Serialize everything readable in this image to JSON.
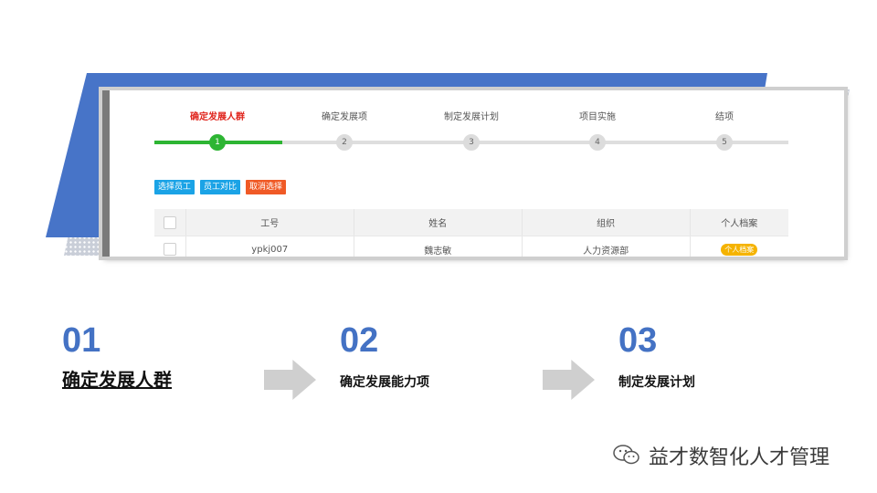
{
  "steps": [
    {
      "label": "确定发展人群",
      "num": "1"
    },
    {
      "label": "确定发展项",
      "num": "2"
    },
    {
      "label": "制定发展计划",
      "num": "3"
    },
    {
      "label": "项目实施",
      "num": "4"
    },
    {
      "label": "结项",
      "num": "5"
    }
  ],
  "buttons": {
    "select_employee": "选择员工",
    "compare_employee": "员工对比",
    "cancel_select": "取消选择"
  },
  "table": {
    "headers": [
      "工号",
      "姓名",
      "组织",
      "个人档案"
    ],
    "rows": [
      {
        "id": "ypkj007",
        "name": "魏志敏",
        "org": "人力资源部",
        "profile": "个人档案"
      }
    ]
  },
  "sections": [
    {
      "num": "01",
      "title": "确定发展人群"
    },
    {
      "num": "02",
      "title": "确定发展能力项"
    },
    {
      "num": "03",
      "title": "制定发展计划"
    }
  ],
  "watermark": {
    "text": "益才数智化人才管理",
    "icon": "wechat-icon"
  },
  "colors": {
    "accent_blue": "#4472c4",
    "step_active": "#2db533",
    "step_label_active": "#e0241c",
    "btn_blue": "#1ba3e6",
    "btn_orange": "#f05a26",
    "badge": "#f5b300"
  }
}
